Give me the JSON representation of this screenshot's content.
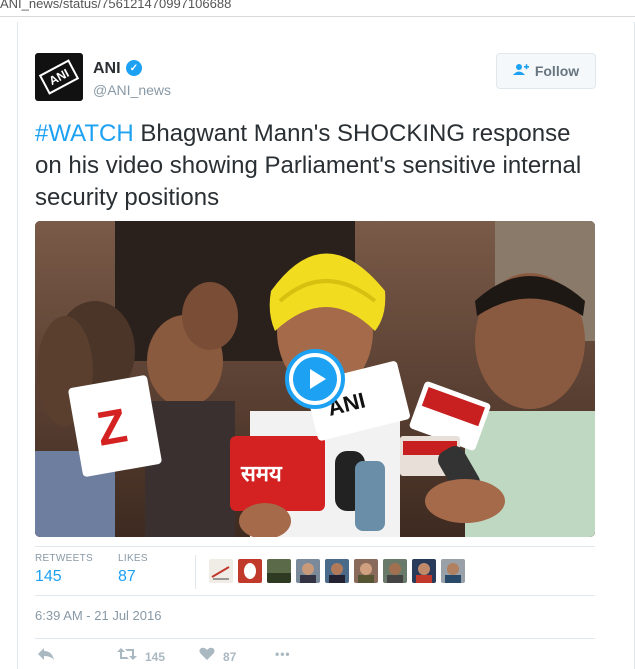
{
  "browser": {
    "url_fragment": "ANI_news/status/756121470997106688"
  },
  "tweet": {
    "author": {
      "name": "ANI",
      "handle": "@ANI_news",
      "verified_glyph": "✓",
      "avatar_text": "ANI"
    },
    "follow_label": "Follow",
    "hashtag": "#WATCH",
    "text": " Bhagwant Mann's SHOCKING response on his video showing Parliament's sensitive internal security positions",
    "stats": {
      "retweets_label": "RETWEETS",
      "retweets_value": "145",
      "likes_label": "LIKES",
      "likes_value": "87"
    },
    "likers_count_shown": 9,
    "timestamp": "6:39 AM - 21 Jul 2016",
    "actions": {
      "retweet_count": "145",
      "like_count": "87",
      "more_glyph": "•••"
    },
    "media": {
      "mic_labels": [
        "ANI",
        "समय",
        "Z"
      ]
    }
  },
  "colors": {
    "accent": "#1da1f2",
    "text": "#292f33",
    "muted": "#8899a6",
    "border": "#e1e8ed",
    "turban_yellow": "#f2dc20",
    "mic_red": "#d42121"
  },
  "icons": {
    "verified": "verified-badge-icon",
    "follow": "add-person-icon",
    "reply": "reply-icon",
    "retweet": "retweet-icon",
    "like": "heart-icon",
    "more": "more-dots-icon",
    "play": "play-icon"
  }
}
